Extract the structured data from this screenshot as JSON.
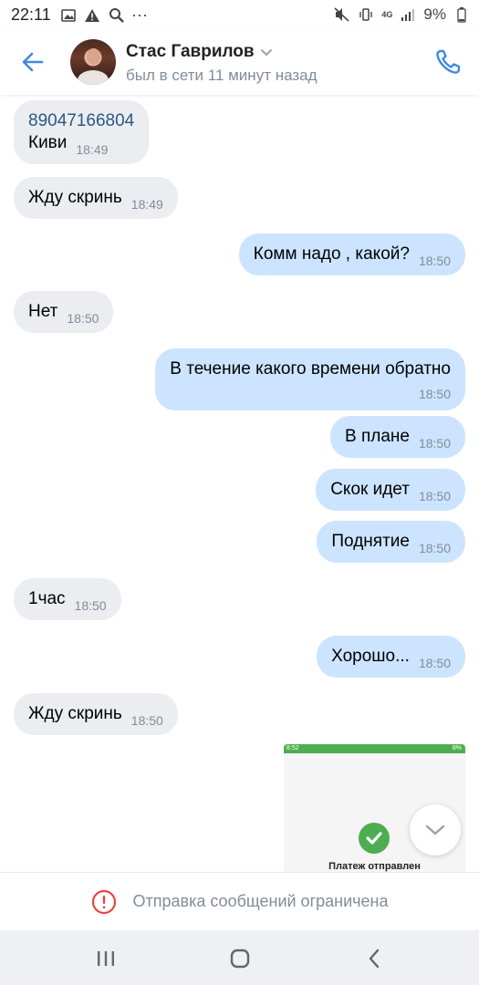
{
  "status_bar": {
    "time": "22:11",
    "left_icons": [
      "image-icon",
      "alert-icon",
      "search-icon",
      "more-icon"
    ],
    "network": "4G",
    "battery": "9%",
    "more_dots": "···"
  },
  "header": {
    "contact_name": "Стас Гаврилов",
    "last_seen": "был в сети 11 минут назад",
    "accent": "#3f8ae0"
  },
  "messages": [
    {
      "dir": "in",
      "lines": [
        "89047166804",
        "Киви"
      ],
      "time": "18:49"
    },
    {
      "dir": "in",
      "text": "Жду скринь",
      "time": "18:49"
    },
    {
      "dir": "out",
      "text": "Комм надо , какой?",
      "time": "18:50"
    },
    {
      "dir": "in",
      "text": "Нет",
      "time": "18:50"
    },
    {
      "dir": "out",
      "text": "В течение какого времени  обратно",
      "time": "18:50"
    },
    {
      "dir": "out",
      "text": "В плане",
      "time": "18:50"
    },
    {
      "dir": "out",
      "text": "Скок идет",
      "time": "18:50"
    },
    {
      "dir": "out",
      "text": "Поднятие",
      "time": "18:50"
    },
    {
      "dir": "in",
      "text": "1час",
      "time": "18:50"
    },
    {
      "dir": "out",
      "text": "Хорошо...",
      "time": "18:50"
    },
    {
      "dir": "in",
      "text": "Жду скринь",
      "time": "18:50"
    }
  ],
  "attachment": {
    "status_time": "8:52",
    "status_battery": "8%",
    "caption": "Платеж отправлен"
  },
  "restriction": {
    "text": "Отправка сообщений ограничена"
  },
  "colors": {
    "incoming_bubble": "#ebedf0",
    "outgoing_bubble": "#cce4ff",
    "link": "#2a5885",
    "secondary": "#818c99",
    "error": "#e64646",
    "success": "#4cae50"
  }
}
